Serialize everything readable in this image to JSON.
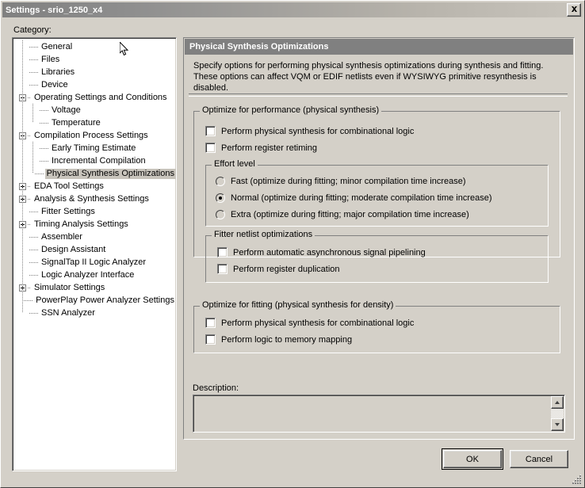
{
  "window": {
    "title": "Settings - srio_1250_x4",
    "close_label": "✕"
  },
  "category": {
    "label": "Category:",
    "items": [
      {
        "label": "General",
        "depth": 1,
        "twisty": "none"
      },
      {
        "label": "Files",
        "depth": 1,
        "twisty": "none"
      },
      {
        "label": "Libraries",
        "depth": 1,
        "twisty": "none"
      },
      {
        "label": "Device",
        "depth": 1,
        "twisty": "none"
      },
      {
        "label": "Operating Settings and Conditions",
        "depth": 0,
        "twisty": "minus"
      },
      {
        "label": "Voltage",
        "depth": 2,
        "twisty": "none"
      },
      {
        "label": "Temperature",
        "depth": 2,
        "twisty": "none"
      },
      {
        "label": "Compilation Process Settings",
        "depth": 0,
        "twisty": "minus"
      },
      {
        "label": "Early Timing Estimate",
        "depth": 2,
        "twisty": "none"
      },
      {
        "label": "Incremental Compilation",
        "depth": 2,
        "twisty": "none"
      },
      {
        "label": "Physical Synthesis Optimizations",
        "depth": 2,
        "twisty": "none",
        "selected": true
      },
      {
        "label": "EDA Tool Settings",
        "depth": 0,
        "twisty": "plus"
      },
      {
        "label": "Analysis & Synthesis Settings",
        "depth": 0,
        "twisty": "plus"
      },
      {
        "label": "Fitter Settings",
        "depth": 1,
        "twisty": "none"
      },
      {
        "label": "Timing Analysis Settings",
        "depth": 0,
        "twisty": "plus"
      },
      {
        "label": "Assembler",
        "depth": 1,
        "twisty": "none"
      },
      {
        "label": "Design Assistant",
        "depth": 1,
        "twisty": "none"
      },
      {
        "label": "SignalTap II Logic Analyzer",
        "depth": 1,
        "twisty": "none"
      },
      {
        "label": "Logic Analyzer Interface",
        "depth": 1,
        "twisty": "none"
      },
      {
        "label": "Simulator Settings",
        "depth": 0,
        "twisty": "plus"
      },
      {
        "label": "PowerPlay Power Analyzer Settings",
        "depth": 1,
        "twisty": "none"
      },
      {
        "label": "SSN Analyzer",
        "depth": 1,
        "twisty": "none"
      }
    ]
  },
  "pane": {
    "header": "Physical Synthesis Optimizations",
    "description": "Specify options for performing physical synthesis optimizations during synthesis and fitting. These options can affect VQM or EDIF netlists even if WYSIWYG primitive resynthesis is disabled."
  },
  "performance_group": {
    "title": "Optimize for performance (physical synthesis)",
    "options": [
      {
        "label": "Perform physical synthesis for combinational logic",
        "checked": false
      },
      {
        "label": "Perform register retiming",
        "checked": false
      }
    ]
  },
  "effort_group": {
    "title": "Effort level",
    "options": [
      {
        "label": "Fast (optimize during fitting; minor compilation time increase)",
        "selected": false
      },
      {
        "label": "Normal (optimize during fitting; moderate compilation time increase)",
        "selected": true
      },
      {
        "label": "Extra (optimize during fitting; major compilation time increase)",
        "selected": false
      }
    ]
  },
  "fitter_netlist_group": {
    "title": "Fitter netlist optimizations",
    "options": [
      {
        "label": "Perform automatic asynchronous signal pipelining",
        "checked": false
      },
      {
        "label": "Perform register duplication",
        "checked": false
      }
    ]
  },
  "fitting_group": {
    "title": "Optimize for fitting (physical synthesis for density)",
    "options": [
      {
        "label": "Perform physical synthesis for combinational logic",
        "checked": false
      },
      {
        "label": "Perform logic to memory mapping",
        "checked": false
      }
    ]
  },
  "description_field": {
    "label": "Description:",
    "value": ""
  },
  "buttons": {
    "ok": "OK",
    "cancel": "Cancel"
  },
  "colors": {
    "face": "#d4d0c8",
    "header_bar": "#808080",
    "selection": "#c8c4bc",
    "text": "#000000"
  }
}
